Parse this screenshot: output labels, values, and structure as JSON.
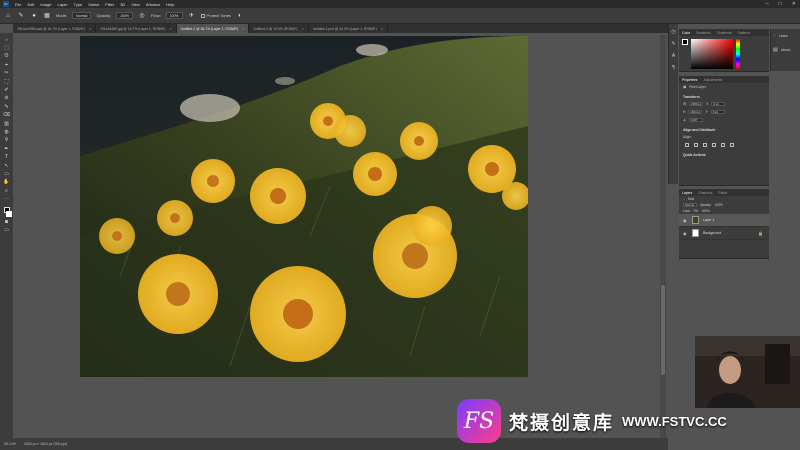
{
  "app": {
    "logo": "Ps"
  },
  "menu": [
    "File",
    "Edit",
    "Image",
    "Layer",
    "Type",
    "Select",
    "Filter",
    "3D",
    "View",
    "Window",
    "Help"
  ],
  "window_controls": [
    "─",
    "□",
    "✕"
  ],
  "options_bar": {
    "mode_label": "Mode:",
    "mode_value": "Normal",
    "opacity_label": "Opacity:",
    "opacity_value": "100%",
    "flow_label": "Flow:",
    "flow_value": "100%",
    "protect_tones_label": "Protect Tones"
  },
  "tabs": [
    {
      "label": "2W1A4498b.psd @ 16.7% (Layer 1, RGB/8*)",
      "active": false
    },
    {
      "label": "2W1A4489.jpg @ 16.7% (Layer 1, RGB/8*)",
      "active": false
    },
    {
      "label": "Untitled-2 @ 36.1% (Layer 1, RGB/8*)",
      "active": true
    },
    {
      "label": "Untitled-3 @ 19.3% (RGB/8*)",
      "active": false
    },
    {
      "label": "Untitled-1.psd @ 44.2% (Layer 1, RGB/8*)",
      "active": false
    }
  ],
  "tools": [
    "⇔",
    "⬚",
    "ʘ",
    "⌖",
    "✂",
    "⛶",
    "✐",
    "⊘",
    "✎",
    "⌫",
    "▥",
    "◍",
    "⚲",
    "✒",
    "T",
    "↖",
    "▭",
    "✋",
    "⌕",
    "⋯"
  ],
  "status": {
    "zoom": "36.14%",
    "doc_size": "2000 px x 1624 px (300 ppi)"
  },
  "color_panel": {
    "tabs": [
      "Color",
      "Swatches",
      "Gradients",
      "Patterns"
    ],
    "active": "Color"
  },
  "properties_panel": {
    "tabs": [
      "Properties",
      "Adjustments"
    ],
    "active": "Properties",
    "layer_type": "Pixel Layer",
    "transform_title": "Transform",
    "w": "2000 px",
    "h": "1624 px",
    "x": "0 px",
    "y": "0 px",
    "angle": "0.00°",
    "align_title": "Align and Distribute",
    "align_label": "Align:",
    "quick_actions_title": "Quick Actions"
  },
  "layers_panel": {
    "tabs": [
      "Layers",
      "Channels",
      "Paths"
    ],
    "active": "Layers",
    "kind_label": "Kind",
    "blend_mode": "Normal",
    "opacity_label": "Opacity:",
    "opacity_value": "100%",
    "lock_label": "Lock:",
    "fill_label": "Fill:",
    "fill_value": "100%",
    "layers": [
      {
        "name": "Layer 1",
        "selected": true
      },
      {
        "name": "Background",
        "selected": false
      }
    ]
  },
  "mini_panel": {
    "items": [
      "Learn",
      "Librari..."
    ]
  },
  "watermark": {
    "logo": "FS",
    "cn": "梵摄创意库",
    "url": "WWW.FSTVC.CC"
  }
}
